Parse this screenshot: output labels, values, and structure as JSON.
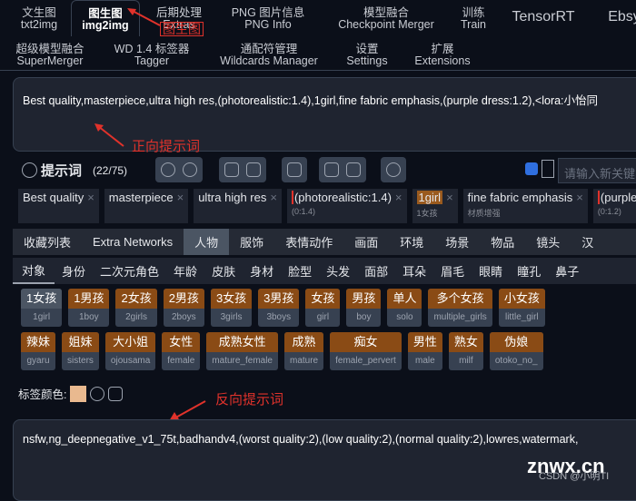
{
  "top_tabs": [
    {
      "zh": "文生图",
      "en": "txt2img"
    },
    {
      "zh": "图生图",
      "en": "img2img",
      "active": true
    },
    {
      "zh": "后期处理",
      "en": "Extras"
    },
    {
      "zh": "PNG 图片信息",
      "en": "PNG Info"
    },
    {
      "zh": "模型融合",
      "en": "Checkpoint Merger"
    },
    {
      "zh": "训练",
      "en": "Train"
    },
    {
      "zh": "",
      "en": "TensorRT"
    },
    {
      "zh": "",
      "en": "Ebsy"
    }
  ],
  "top_tabs2": [
    {
      "zh": "超级模型融合",
      "en": "SuperMerger"
    },
    {
      "zh": "WD 1.4 标签器",
      "en": "Tagger"
    },
    {
      "zh": "通配符管理",
      "en": "Wildcards Manager"
    },
    {
      "zh": "设置",
      "en": "Settings"
    },
    {
      "zh": "扩展",
      "en": "Extensions"
    }
  ],
  "annotations": {
    "tab": "图生图",
    "positive": "正向提示词",
    "negative": "反向提示词",
    "color": "#e0322b"
  },
  "positive_prompt": "Best quality,masterpiece,ultra high res,(photorealistic:1.4),1girl,fine fabric emphasis,(purple dress:1.2),<lora:小怡同",
  "prompt_header": {
    "title": "提示词",
    "count": "(22/75)",
    "search_placeholder": "请输入新关键"
  },
  "prompt_tags": [
    {
      "text": "Best quality",
      "sub": ""
    },
    {
      "text": "masterpiece",
      "sub": ""
    },
    {
      "text": "ultra high res",
      "sub": ""
    },
    {
      "text": "(photorealistic:1.4)",
      "sub": "(0:1.4)"
    },
    {
      "text": "1girl",
      "sub": "1女孩"
    },
    {
      "text": "fine fabric emphasis",
      "sub": "材质增强"
    },
    {
      "text": "(purple d",
      "sub": "(0:1.2)"
    }
  ],
  "categories": [
    "收藏列表",
    "Extra Networks",
    "人物",
    "服饰",
    "表情动作",
    "画面",
    "环境",
    "场景",
    "物品",
    "镜头",
    "汉"
  ],
  "active_category": "人物",
  "subcategories": [
    "对象",
    "身份",
    "二次元角色",
    "年龄",
    "皮肤",
    "身材",
    "脸型",
    "头发",
    "面部",
    "耳朵",
    "眉毛",
    "眼睛",
    "瞳孔",
    "鼻子"
  ],
  "tag_rows": [
    [
      {
        "cn": "1女孩",
        "en": "1girl",
        "selected": true
      },
      {
        "cn": "1男孩",
        "en": "1boy"
      },
      {
        "cn": "2女孩",
        "en": "2girls"
      },
      {
        "cn": "2男孩",
        "en": "2boys"
      },
      {
        "cn": "3女孩",
        "en": "3girls"
      },
      {
        "cn": "3男孩",
        "en": "3boys"
      },
      {
        "cn": "女孩",
        "en": "girl"
      },
      {
        "cn": "男孩",
        "en": "boy"
      },
      {
        "cn": "单人",
        "en": "solo"
      },
      {
        "cn": "多个女孩",
        "en": "multiple_girls"
      },
      {
        "cn": "小女孩",
        "en": "little_girl"
      }
    ],
    [
      {
        "cn": "辣妹",
        "en": "gyaru"
      },
      {
        "cn": "姐妹",
        "en": "sisters"
      },
      {
        "cn": "大小姐",
        "en": "ojousama"
      },
      {
        "cn": "女性",
        "en": "female"
      },
      {
        "cn": "成熟女性",
        "en": "mature_female"
      },
      {
        "cn": "成熟",
        "en": "mature"
      },
      {
        "cn": "痴女",
        "en": "female_pervert"
      },
      {
        "cn": "男性",
        "en": "male"
      },
      {
        "cn": "熟女",
        "en": "milf"
      },
      {
        "cn": "伪娘",
        "en": "otoko_no_"
      }
    ]
  ],
  "tag_color_label": "标签颜色:",
  "negative_prompt": "nsfw,ng_deepnegative_v1_75t,badhandv4,(worst quality:2),(low quality:2),(normal quality:2),lowres,watermark,",
  "watermark": {
    "site": "znwx.cn",
    "credit": "CSDN @小明TI"
  }
}
